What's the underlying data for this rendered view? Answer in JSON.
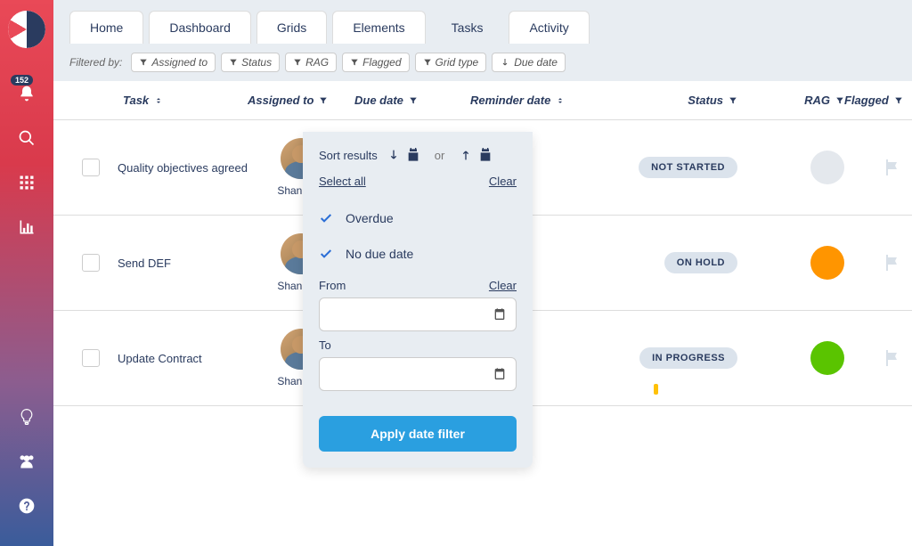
{
  "sidebar": {
    "badge_count": "152"
  },
  "tabs": [
    "Home",
    "Dashboard",
    "Grids",
    "Elements",
    "Tasks",
    "Activity"
  ],
  "active_tab_index": 4,
  "filterbar": {
    "label": "Filtered by:",
    "chips": [
      "Assigned to",
      "Status",
      "RAG",
      "Flagged",
      "Grid type",
      "Due date"
    ]
  },
  "columns": {
    "task": "Task",
    "assigned": "Assigned to",
    "due": "Due date",
    "reminder": "Reminder date",
    "status": "Status",
    "rag": "RAG",
    "flagged": "Flagged"
  },
  "rows": [
    {
      "task": "Quality objectives agreed",
      "assigned": "Shan Dad",
      "status": "NOT STARTED",
      "rag": "none"
    },
    {
      "task": "Send DEF",
      "assigned": "Shan Dad",
      "status": "ON HOLD",
      "rag": "amber"
    },
    {
      "task": "Update Contract",
      "assigned": "Shan Dad",
      "status": "IN PROGRESS",
      "rag": "green"
    }
  ],
  "popover": {
    "sort_label": "Sort results",
    "or": "or",
    "select_all": "Select all",
    "clear": "Clear",
    "options": {
      "overdue": "Overdue",
      "no_due": "No due date"
    },
    "from_label": "From",
    "to_label": "To",
    "apply": "Apply date filter"
  }
}
